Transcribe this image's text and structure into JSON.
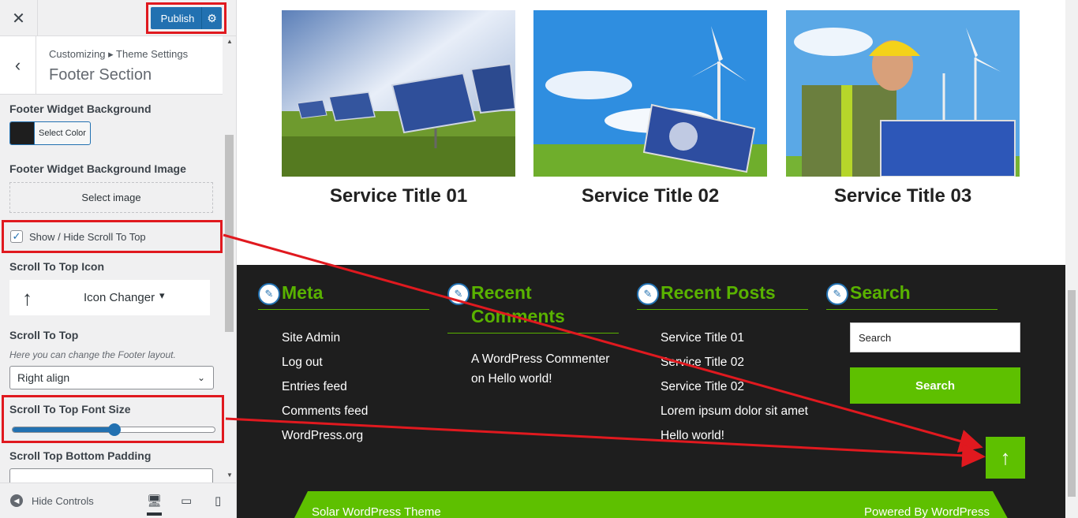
{
  "panel": {
    "close_icon": "close-icon",
    "publish_label": "Publish",
    "breadcrumb": "Customizing ▸ Theme Settings",
    "section_title": "Footer Section",
    "controls": {
      "bg_label": "Footer Widget Background",
      "select_color": "Select Color",
      "bg_color": "#1e1e1e",
      "bg_image_label": "Footer Widget Background Image",
      "select_image": "Select image",
      "scroll_toggle_label": "Show / Hide Scroll To Top",
      "scroll_toggle_checked": true,
      "icon_label": "Scroll To Top Icon",
      "icon_changer": "Icon Changer",
      "scroll_label": "Scroll To Top",
      "scroll_desc": "Here you can change the Footer layout.",
      "align_value": "Right align",
      "font_size_label": "Scroll To Top Font Size",
      "font_size_fraction": 0.5,
      "padding_label": "Scroll Top Bottom Padding"
    },
    "footer": {
      "hide_controls": "Hide Controls"
    }
  },
  "preview": {
    "services": [
      {
        "title": "Service Title 01"
      },
      {
        "title": "Service Title 02"
      },
      {
        "title": "Service Title 03"
      }
    ],
    "widgets": {
      "meta": {
        "title": "Meta",
        "items": [
          "Site Admin",
          "Log out",
          "Entries feed",
          "Comments feed",
          "WordPress.org"
        ]
      },
      "recent_comments": {
        "title": "Recent Comments",
        "text": "A WordPress Commenter on Hello world!"
      },
      "recent_posts": {
        "title": "Recent Posts",
        "items": [
          "Service Title 01",
          "Service Title 02",
          "Service Title 02",
          "Lorem ipsum dolor sit amet",
          "Hello world!"
        ]
      },
      "search": {
        "title": "Search",
        "placeholder": "Search",
        "button": "Search"
      }
    },
    "bottom": {
      "left": "Solar WordPress Theme",
      "right": "Powered By WordPress"
    },
    "accent": "#5ec000"
  }
}
